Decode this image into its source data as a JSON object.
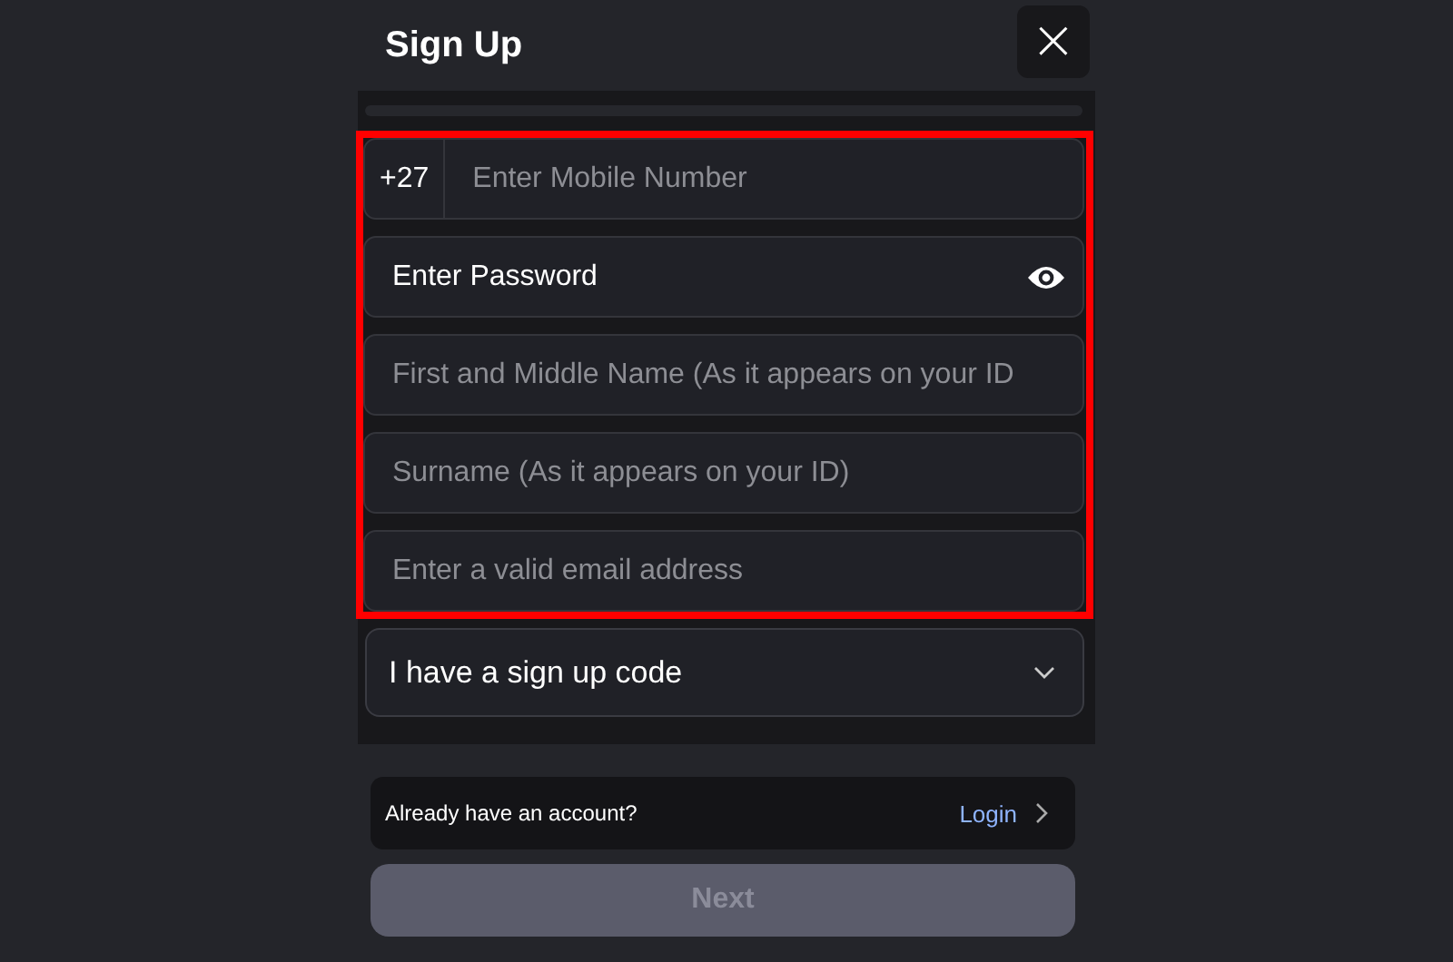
{
  "dialog": {
    "title": "Sign Up",
    "close": "×"
  },
  "fields": [
    {
      "kind": "phone",
      "prefix": "+27",
      "placeholder": "Enter Mobile Number",
      "highlighted": true
    },
    {
      "kind": "password",
      "placeholder": "Enter Password",
      "highlighted": true
    },
    {
      "kind": "text",
      "placeholder": "First and Middle Name (As it appears on your ID",
      "highlighted": true
    },
    {
      "kind": "text",
      "placeholder": "Surname (As it appears on your ID)",
      "highlighted": true
    },
    {
      "kind": "text",
      "placeholder": "Enter a valid email address",
      "highlighted": true
    }
  ],
  "signup_code": {
    "label": "I have a sign up code",
    "expanded": false
  },
  "login_row": {
    "text": "Already have an account?",
    "link": "Login"
  },
  "next_button": {
    "label": "Next",
    "disabled": true
  }
}
